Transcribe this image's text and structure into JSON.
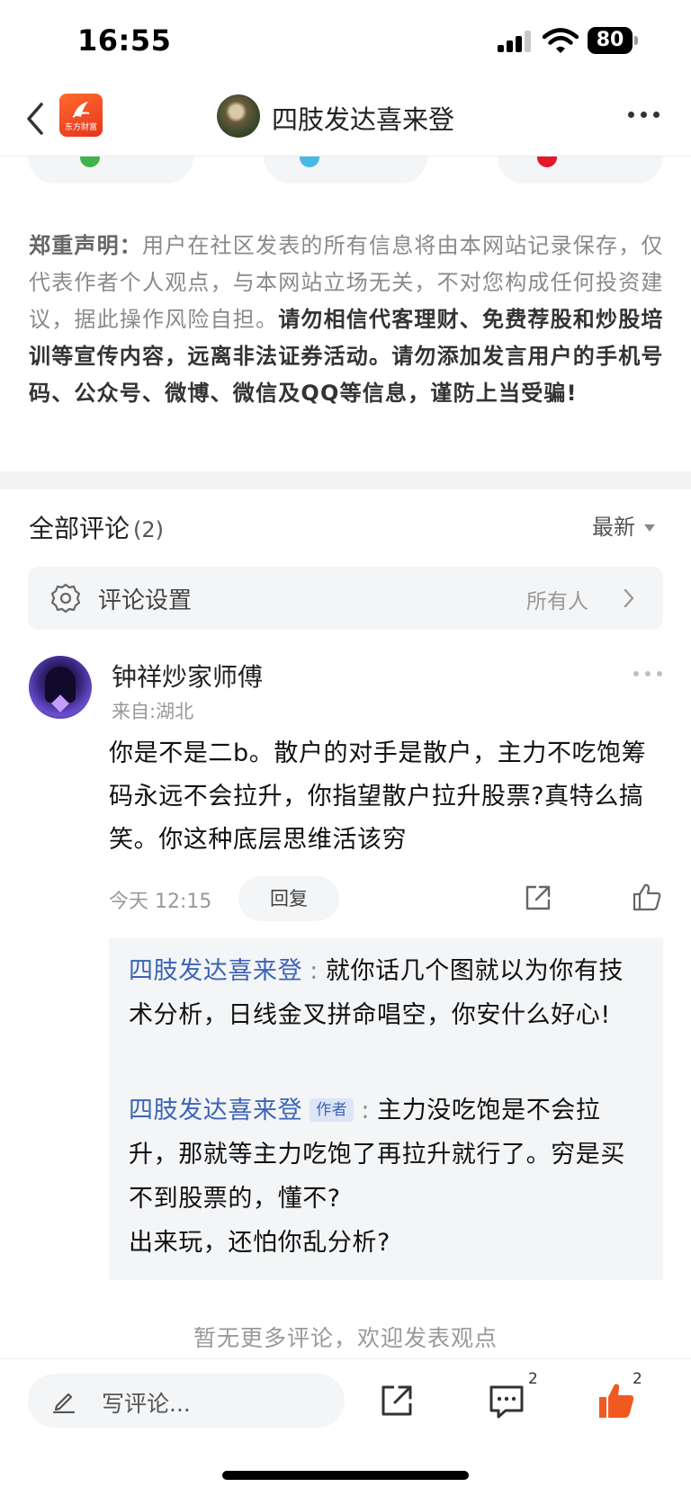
{
  "status_bar": {
    "time": "16:55",
    "battery": "80"
  },
  "nav": {
    "logo_text": "东方财富",
    "title": "四肢发达喜来登"
  },
  "disclaimer": {
    "label": "郑重声明：",
    "normal_text": "用户在社区发表的所有信息将由本网站记录保存，仅代表作者个人观点，与本网站立场无关，不对您构成任何投资建议，据此操作风险自担。",
    "bold_text": "请勿相信代客理财、免费荐股和炒股培训等宣传内容，远离非法证券活动。请勿添加发言用户的手机号码、公众号、微博、微信及QQ等信息，谨防上当受骗!"
  },
  "comments": {
    "header": "全部评论",
    "count": "(2)",
    "sort_label": "最新",
    "settings": {
      "label": "评论设置",
      "value": "所有人"
    },
    "items": [
      {
        "author": "钟祥炒家师傅",
        "location": "来自:湖北",
        "body": "你是不是二b。散户的对手是散户，主力不吃饱筹码永远不会拉升，你指望散户拉升股票?真特么搞笑。你这种底层思维活该穷",
        "time": "今天 12:15",
        "reply_label": "回复",
        "replies": [
          {
            "name": "四肢发达喜来登",
            "colon": ":",
            "text": "就你话几个图就以为你有技术分析，日线金叉拼命唱空，你安什么好心!"
          },
          {
            "name": "四肢发达喜来登",
            "tag": "作者",
            "colon": ":",
            "text_1": "主力没吃饱是不会拉升，那就等主力吃饱了再拉升就行了。穷是买不到股票的，懂不?",
            "text_2": "出来玩，还怕你乱分析?"
          }
        ]
      }
    ],
    "no_more": "暂无更多评论，欢迎发表观点"
  },
  "bottom_bar": {
    "input_placeholder": "写评论...",
    "comments_count": "2",
    "likes_count": "2",
    "accent_color": "#f05a22"
  }
}
